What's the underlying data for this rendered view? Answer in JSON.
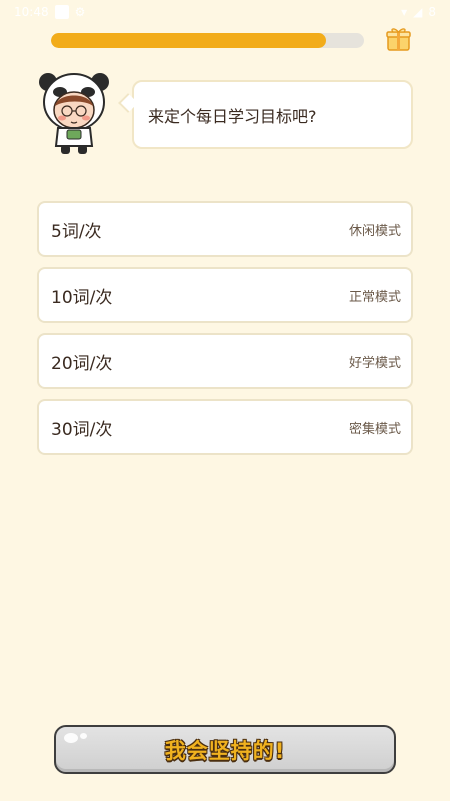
{
  "status_bar": {
    "time": "10:48",
    "battery": "8"
  },
  "progress": {
    "fraction": 0.88,
    "fill_color": "#F2AC1A",
    "track_color": "#E6E3DC"
  },
  "gift": {
    "icon": "gift-icon"
  },
  "prompt": {
    "text": "来定个每日学习目标吧?"
  },
  "options": [
    {
      "count": "5词/次",
      "mode": "休闲模式"
    },
    {
      "count": "10词/次",
      "mode": "正常模式"
    },
    {
      "count": "20词/次",
      "mode": "好学模式"
    },
    {
      "count": "30词/次",
      "mode": "密集模式"
    }
  ],
  "commit_button": {
    "label": "我会坚持的!"
  },
  "colors": {
    "background": "#FEF7E3",
    "accent": "#F2AC1A",
    "text": "#3A2A20"
  }
}
